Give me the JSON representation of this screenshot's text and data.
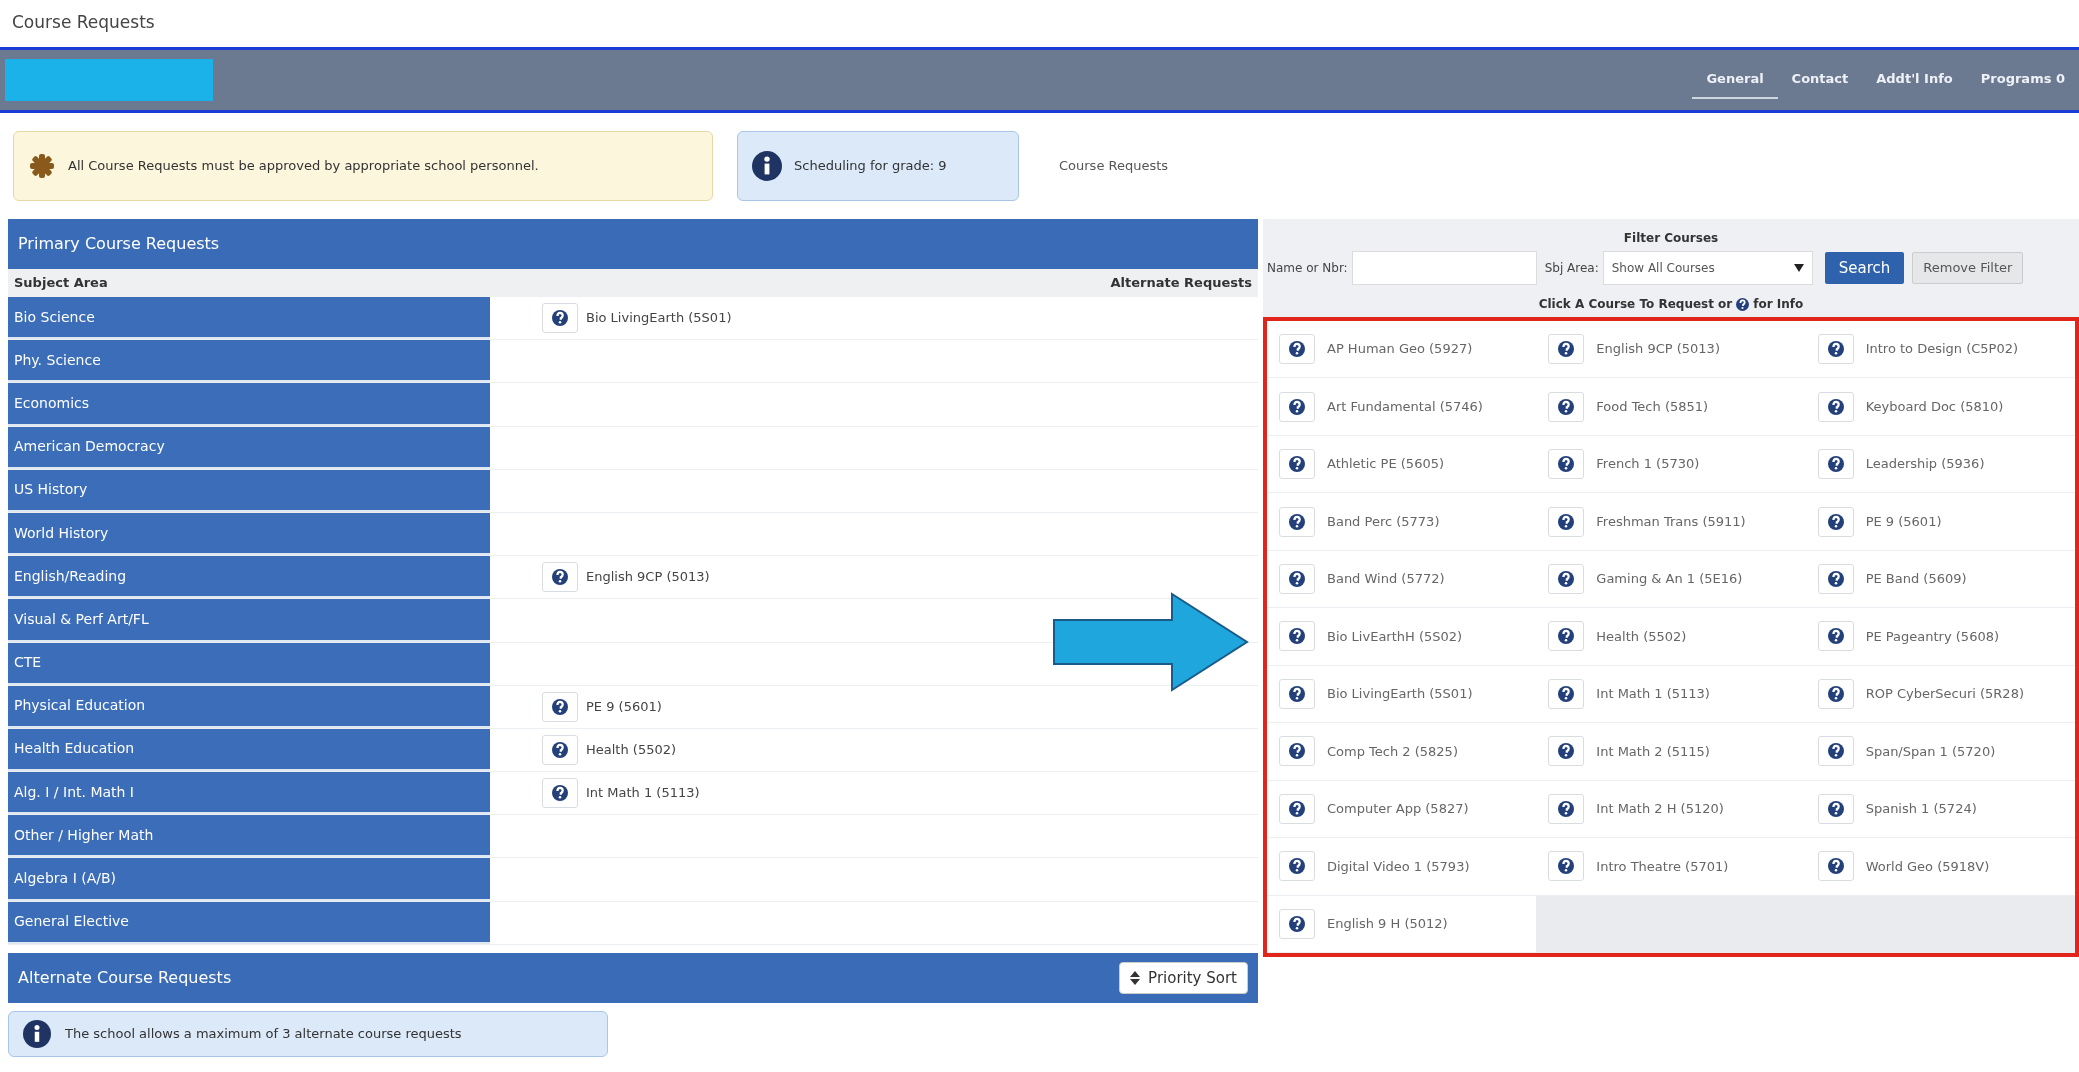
{
  "page_title": "Course Requests",
  "nav": {
    "tabs": [
      {
        "label": "General",
        "selected": true
      },
      {
        "label": "Contact",
        "selected": false
      },
      {
        "label": "Addt'l Info",
        "selected": false
      },
      {
        "label": "Programs 0",
        "selected": false
      }
    ]
  },
  "notices": [
    {
      "kind": "warning",
      "text": "All Course Requests must be approved by appropriate school personnel."
    },
    {
      "kind": "info",
      "text": "Scheduling for grade: 9"
    }
  ],
  "breadcrumb": "Course Requests",
  "primary": {
    "title": "Primary Course Requests",
    "columns": [
      "Subject Area",
      "Alternate Requests"
    ],
    "rows": [
      {
        "subject": "Bio Science",
        "course": "Bio LivingEarth (5S01)"
      },
      {
        "subject": "Phy. Science"
      },
      {
        "subject": "Economics"
      },
      {
        "subject": "American Democracy"
      },
      {
        "subject": "US History"
      },
      {
        "subject": "World History"
      },
      {
        "subject": "English/Reading",
        "course": "English 9CP (5013)"
      },
      {
        "subject": "Visual & Perf Art/FL"
      },
      {
        "subject": "CTE"
      },
      {
        "subject": "Physical Education",
        "course": "PE 9 (5601)"
      },
      {
        "subject": "Health Education",
        "course": "Health (5502)"
      },
      {
        "subject": "Alg. I / Int. Math I",
        "course": "Int Math 1 (5113)"
      },
      {
        "subject": "Other / Higher Math"
      },
      {
        "subject": "Algebra I (A/B)"
      },
      {
        "subject": "General Elective"
      }
    ]
  },
  "alternate": {
    "title": "Alternate Course Requests",
    "sort_button": "Priority Sort",
    "notice": "The school allows a maximum of 3 alternate course requests"
  },
  "filter": {
    "title": "Filter Courses",
    "name_label": "Name or Nbr:",
    "subject_label": "Sbj Area:",
    "subject_value": "Show All Courses",
    "search_button": "Search",
    "remove_button": "Remove Filter",
    "hint_before": "Click A Course To Request or",
    "hint_after": "for Info"
  },
  "courses": [
    "AP Human Geo (5927)",
    "English 9CP (5013)",
    "Intro to Design (C5P02)",
    "Art Fundamental (5746)",
    "Food Tech (5851)",
    "Keyboard Doc (5810)",
    "Athletic PE (5605)",
    "French 1 (5730)",
    "Leadership (5936)",
    "Band Perc (5773)",
    "Freshman Trans (5911)",
    "PE 9 (5601)",
    "Band Wind (5772)",
    "Gaming & An 1 (5E16)",
    "PE Band (5609)",
    "Bio LivEarthH (5S02)",
    "Health (5502)",
    "PE Pageantry (5608)",
    "Bio LivingEarth (5S01)",
    "Int Math 1 (5113)",
    "ROP CyberSecuri (5R28)",
    "Comp Tech 2 (5825)",
    "Int Math 2 (5115)",
    "Span/Span 1 (5720)",
    "Computer App (5827)",
    "Int Math 2 H (5120)",
    "Spanish 1 (5724)",
    "Digital Video 1 (5793)",
    "Intro Theatre (5701)",
    "World Geo (5918V)",
    "English 9 H (5012)"
  ]
}
